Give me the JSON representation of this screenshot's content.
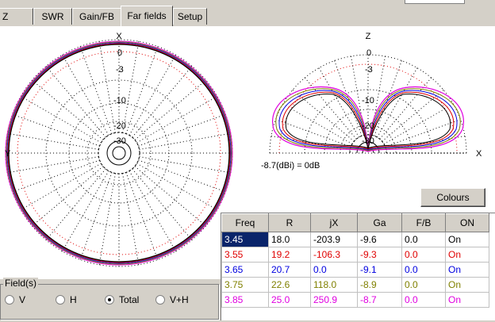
{
  "tabs": [
    {
      "label": "Z",
      "active": false
    },
    {
      "label": "SWR",
      "active": false
    },
    {
      "label": "Gain/FB",
      "active": false
    },
    {
      "label": "Far fields",
      "active": true
    },
    {
      "label": "Setup",
      "active": false
    }
  ],
  "left_plot": {
    "top_axis": "X",
    "left_axis": "Y",
    "ring_labels": [
      "0",
      "-3",
      "-10",
      "-20",
      "-30"
    ]
  },
  "right_plot": {
    "top_axis": "Z",
    "right_axis": "X",
    "ring_labels": [
      "0",
      "-3",
      "-10",
      "-20",
      "-30"
    ]
  },
  "gain_note": "-8.7(dBi) = 0dB",
  "colours_button": "Colours",
  "fields": {
    "label": "Field(s)",
    "options": [
      {
        "label": "V",
        "selected": false
      },
      {
        "label": "H",
        "selected": false
      },
      {
        "label": "Total",
        "selected": true
      },
      {
        "label": "V+H",
        "selected": false
      }
    ]
  },
  "table": {
    "headers": [
      "Freq",
      "R",
      "jX",
      "Ga",
      "F/B",
      "ON"
    ],
    "rows": [
      {
        "color": "#ffffff",
        "cells": [
          "3.45",
          "18.0",
          "-203.9",
          "-9.6",
          "0.0",
          "On"
        ],
        "series_color": "#000000"
      },
      {
        "color": "#e00000",
        "cells": [
          "3.55",
          "19.2",
          "-106.3",
          "-9.3",
          "0.0",
          "On"
        ],
        "series_color": "#e00000"
      },
      {
        "color": "#0000e0",
        "cells": [
          "3.65",
          "20.7",
          "0.0",
          "-9.1",
          "0.0",
          "On"
        ],
        "series_color": "#0000e0"
      },
      {
        "color": "#808000",
        "cells": [
          "3.75",
          "22.6",
          "118.0",
          "-8.9",
          "0.0",
          "On"
        ],
        "series_color": "#808000"
      },
      {
        "color": "#e000e0",
        "cells": [
          "3.85",
          "25.0",
          "250.9",
          "-8.7",
          "0.0",
          "On"
        ],
        "series_color": "#e000e0"
      }
    ]
  }
}
